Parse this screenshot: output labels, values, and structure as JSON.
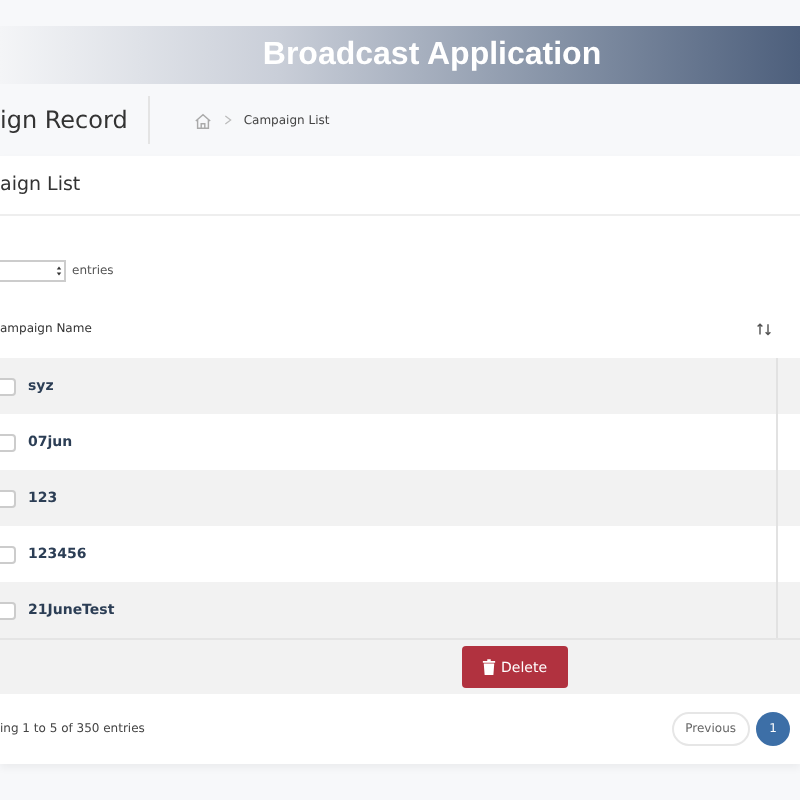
{
  "header": {
    "title": "Broadcast Application"
  },
  "page": {
    "title": "ign Record",
    "breadcrumb": [
      "Campaign List"
    ]
  },
  "card": {
    "title": "aign List",
    "length_menu": {
      "label": "entries"
    },
    "table": {
      "columns": [
        "ampaign Name"
      ],
      "rows": [
        {
          "name": "syz",
          "checked": false
        },
        {
          "name": "07jun",
          "checked": false
        },
        {
          "name": "123",
          "checked": false
        },
        {
          "name": "123456",
          "checked": false
        },
        {
          "name": "21JuneTest",
          "checked": false
        }
      ]
    },
    "delete_button": "Delete",
    "info": "ing 1 to 5 of 350 entries",
    "pagination": [
      {
        "label": "Previous",
        "kind": "nav",
        "selected": false
      },
      {
        "label": "1",
        "kind": "page",
        "selected": true
      }
    ]
  }
}
